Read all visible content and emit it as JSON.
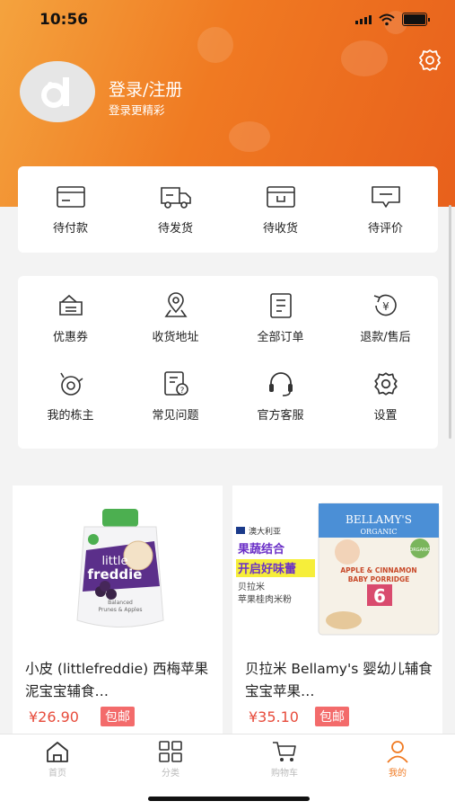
{
  "status": {
    "time": "10:56"
  },
  "profile": {
    "title": "登录/注册",
    "subtitle": "登录更精彩"
  },
  "orders": [
    {
      "label": "待付款",
      "icon": "wallet-icon"
    },
    {
      "label": "待发货",
      "icon": "truck-icon"
    },
    {
      "label": "待收货",
      "icon": "package-icon"
    },
    {
      "label": "待评价",
      "icon": "comment-icon"
    }
  ],
  "services_row1": [
    {
      "label": "优惠券",
      "icon": "coupon-icon"
    },
    {
      "label": "收货地址",
      "icon": "location-icon"
    },
    {
      "label": "全部订单",
      "icon": "document-icon"
    },
    {
      "label": "退款/售后",
      "icon": "refund-icon"
    }
  ],
  "services_row2": [
    {
      "label": "我的栋主",
      "icon": "camera-icon"
    },
    {
      "label": "常见问题",
      "icon": "faq-icon"
    },
    {
      "label": "官方客服",
      "icon": "headset-icon"
    },
    {
      "label": "设置",
      "icon": "gear-icon"
    }
  ],
  "products": [
    {
      "name": "小皮 (littlefreddie) 西梅苹果泥宝宝辅食…",
      "price": "¥26.90",
      "tag": "包邮",
      "image_text": {
        "brand1": "little",
        "brand2": "freddie",
        "sub1": "Balanced",
        "sub2": "Prunes & Apples"
      }
    },
    {
      "name": "贝拉米 Bellamy's 婴幼儿辅食 宝宝苹果…",
      "price": "¥35.10",
      "tag": "包邮",
      "image_text": {
        "origin": "澳大利亚",
        "slogan1": "果蔬结合",
        "slogan2": "开启好味蕾",
        "line1": "贝拉米",
        "line2": "苹果桂肉米粉",
        "brand": "BELLAMY'S",
        "brand_sub": "ORGANIC",
        "prod1": "APPLE & CINNAMON",
        "prod2": "BABY PORRIDGE",
        "age": "6",
        "organic": "ORGANIC"
      }
    }
  ],
  "tabs": [
    {
      "label": "首页",
      "icon": "home-icon"
    },
    {
      "label": "分类",
      "icon": "category-icon"
    },
    {
      "label": "购物车",
      "icon": "cart-icon"
    },
    {
      "label": "我的",
      "icon": "user-icon"
    }
  ],
  "colors": {
    "accent": "#f07a22",
    "price": "#e74c3c",
    "tag": "#f36b6b"
  }
}
